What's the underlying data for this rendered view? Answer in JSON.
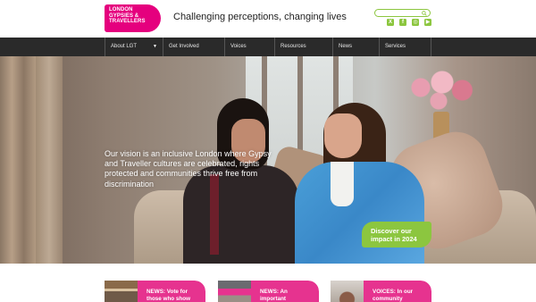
{
  "logo": {
    "lines": [
      "LONDON",
      "GYPSIES &",
      "TRAVELLERS"
    ],
    "color": "#e5007e"
  },
  "header": {
    "tagline": "Challenging perceptions, changing lives",
    "search": {
      "placeholder": "",
      "icon": "search-icon"
    },
    "socials": [
      {
        "name": "x-icon",
        "glyph": "X"
      },
      {
        "name": "facebook-icon",
        "glyph": "f"
      },
      {
        "name": "instagram-icon",
        "glyph": "◎"
      },
      {
        "name": "youtube-icon",
        "glyph": "▶"
      }
    ],
    "accent": "#8cc63f"
  },
  "nav": {
    "items": [
      {
        "label": "About LGT",
        "caret": "▼"
      },
      {
        "label": "Get Involved"
      },
      {
        "label": "Voices"
      },
      {
        "label": "Resources"
      },
      {
        "label": "News"
      },
      {
        "label": "Services"
      }
    ]
  },
  "hero": {
    "text": "Our vision is an inclusive London where Gypsy and Traveller cultures are celebrated, rights protected and communities thrive free from discrimination",
    "cta": "Discover our impact in 2024"
  },
  "cards": [
    {
      "title": "NEWS: Vote for those who show"
    },
    {
      "title": "NEWS: An important"
    },
    {
      "title": "VOICES: In our community"
    }
  ]
}
